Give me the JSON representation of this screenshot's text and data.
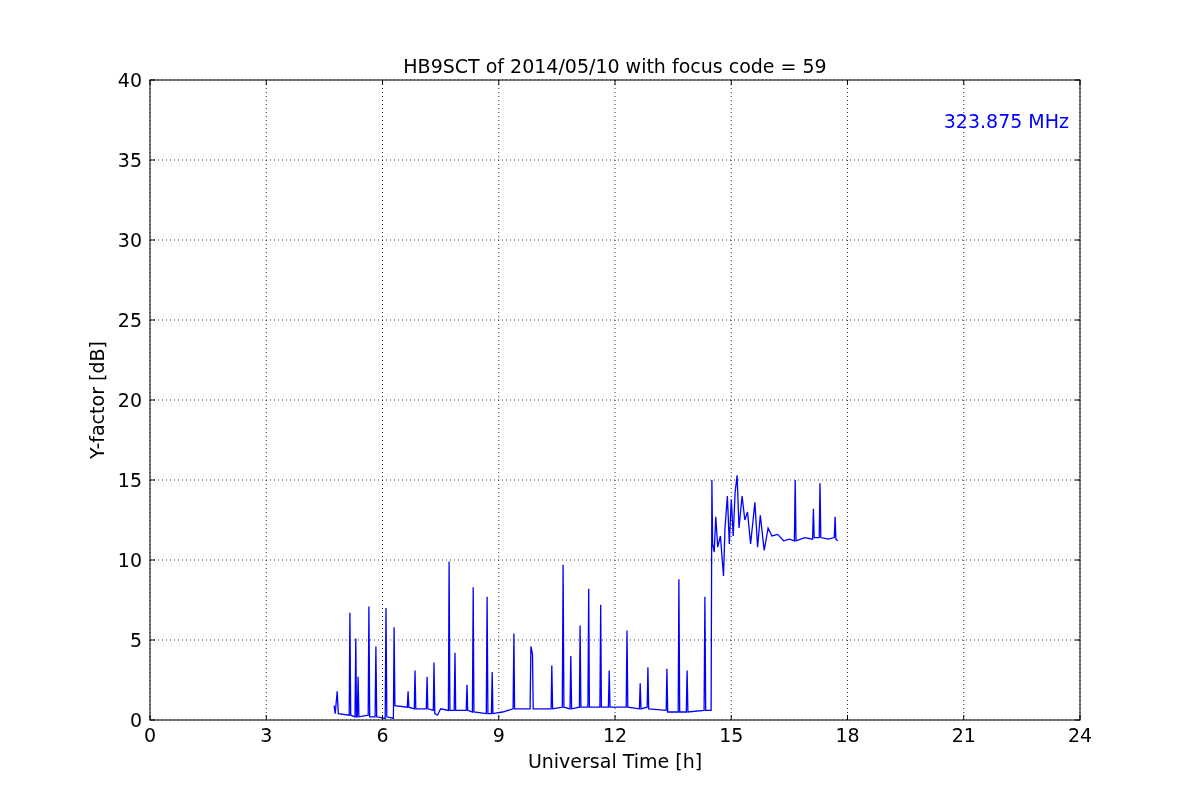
{
  "chart_data": {
    "type": "line",
    "title": "HB9SCT of 2014/05/10 with focus code = 59",
    "xlabel": "Universal Time [h]",
    "ylabel": "Y-factor [dB]",
    "xlim": [
      0,
      24
    ],
    "ylim": [
      0,
      40
    ],
    "xticks": [
      0,
      3,
      6,
      9,
      12,
      15,
      18,
      21,
      24
    ],
    "yticks": [
      0,
      5,
      10,
      15,
      20,
      25,
      30,
      35,
      40
    ],
    "x": [
      4.75,
      4.78,
      4.83,
      4.86,
      5.14,
      5.16,
      5.18,
      5.29,
      5.31,
      5.33,
      5.35,
      5.37,
      5.39,
      5.63,
      5.65,
      5.67,
      5.81,
      5.83,
      5.85,
      6.07,
      6.09,
      6.11,
      6.28,
      6.3,
      6.32,
      6.64,
      6.66,
      6.68,
      6.82,
      6.84,
      6.86,
      7.13,
      7.15,
      7.17,
      7.31,
      7.33,
      7.35,
      7.42,
      7.5,
      7.7,
      7.72,
      7.74,
      7.85,
      7.87,
      7.89,
      8.16,
      8.18,
      8.2,
      8.32,
      8.34,
      8.36,
      8.68,
      8.7,
      8.72,
      8.81,
      8.83,
      8.85,
      9.1,
      9.37,
      9.39,
      9.41,
      9.81,
      9.83,
      9.87,
      9.89,
      10.35,
      10.37,
      10.39,
      10.64,
      10.66,
      10.68,
      10.84,
      10.86,
      10.88,
      11.08,
      11.1,
      11.12,
      11.3,
      11.32,
      11.34,
      11.61,
      11.63,
      11.65,
      11.83,
      11.85,
      11.87,
      12.29,
      12.31,
      12.33,
      12.63,
      12.65,
      12.67,
      12.83,
      12.85,
      12.87,
      13.32,
      13.34,
      13.36,
      13.63,
      13.65,
      13.67,
      13.84,
      13.86,
      13.88,
      14.3,
      14.32,
      14.34,
      14.48,
      14.5,
      14.52,
      14.56,
      14.6,
      14.65,
      14.72,
      14.8,
      14.84,
      14.9,
      14.95,
      15.0,
      15.05,
      15.1,
      15.15,
      15.2,
      15.28,
      15.35,
      15.42,
      15.5,
      15.61,
      15.68,
      15.75,
      15.85,
      15.95,
      16.05,
      16.2,
      16.35,
      16.5,
      16.63,
      16.65,
      16.67,
      16.9,
      17.1,
      17.12,
      17.14,
      17.27,
      17.29,
      17.31,
      17.5,
      17.66,
      17.68,
      17.7,
      17.75
    ],
    "series": [
      {
        "color": "#0000ff",
        "values": [
          0.9,
          0.4,
          1.8,
          0.4,
          0.3,
          6.7,
          0.3,
          0.2,
          5.1,
          0.2,
          0.2,
          2.7,
          0.2,
          0.3,
          7.1,
          0.2,
          0.2,
          4.6,
          0.2,
          0.1,
          7.0,
          0.2,
          0.1,
          5.8,
          0.9,
          0.8,
          1.8,
          0.8,
          0.7,
          3.1,
          0.7,
          0.7,
          2.7,
          0.7,
          0.6,
          3.6,
          0.4,
          0.3,
          0.7,
          0.6,
          9.9,
          0.6,
          0.6,
          4.2,
          0.6,
          0.6,
          2.2,
          0.6,
          0.5,
          8.3,
          0.5,
          0.4,
          7.7,
          0.4,
          0.4,
          3.0,
          0.4,
          0.5,
          0.7,
          5.4,
          0.7,
          0.7,
          4.6,
          4.1,
          0.7,
          0.7,
          3.4,
          0.7,
          0.8,
          9.7,
          0.8,
          0.7,
          4.0,
          0.7,
          0.8,
          5.9,
          0.8,
          0.8,
          8.2,
          0.8,
          0.8,
          7.2,
          0.8,
          0.8,
          3.1,
          0.8,
          0.8,
          5.6,
          0.8,
          0.7,
          2.3,
          0.7,
          0.8,
          3.3,
          0.7,
          0.6,
          3.2,
          0.5,
          0.5,
          8.8,
          0.5,
          0.5,
          3.1,
          0.5,
          0.6,
          7.7,
          0.6,
          0.6,
          15.0,
          11.0,
          10.5,
          12.7,
          10.8,
          11.5,
          9.0,
          12.0,
          14.0,
          11.0,
          13.8,
          11.5,
          14.2,
          15.3,
          12.0,
          14.0,
          12.5,
          13.0,
          11.0,
          13.6,
          10.8,
          12.8,
          10.6,
          12.0,
          11.5,
          11.6,
          11.2,
          11.3,
          11.2,
          15.0,
          11.2,
          11.4,
          11.3,
          13.2,
          11.4,
          11.4,
          14.8,
          11.4,
          11.3,
          11.4,
          12.7,
          11.3,
          11.2
        ]
      }
    ],
    "grid": true,
    "annotations": [
      "323.875 MHz"
    ]
  }
}
